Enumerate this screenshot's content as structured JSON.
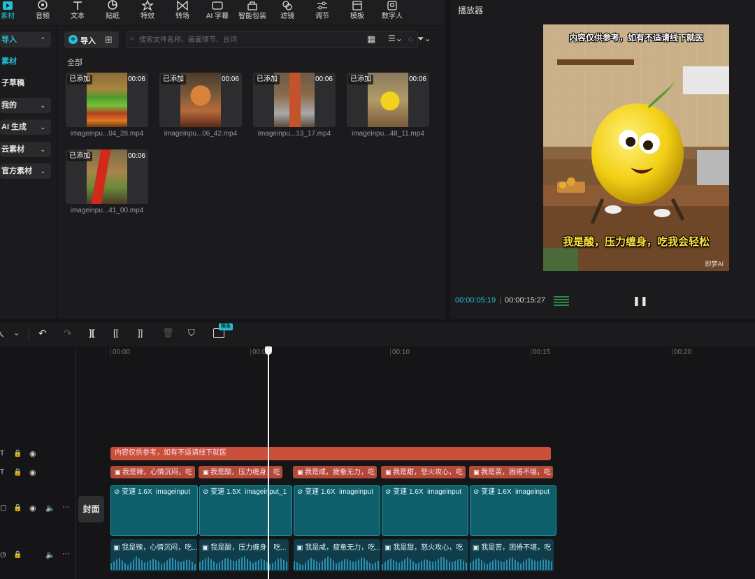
{
  "toolbar": {
    "tabs": [
      {
        "label": "素材",
        "icon": "media-icon"
      },
      {
        "label": "音频",
        "icon": "audio-icon"
      },
      {
        "label": "文本",
        "icon": "text-icon"
      },
      {
        "label": "贴纸",
        "icon": "sticker-icon"
      },
      {
        "label": "特效",
        "icon": "effects-icon"
      },
      {
        "label": "转场",
        "icon": "transition-icon"
      },
      {
        "label": "AI 字幕",
        "icon": "ai-caption-icon"
      },
      {
        "label": "智能包装",
        "icon": "smart-pack-icon"
      },
      {
        "label": "滤镜",
        "icon": "filter-icon"
      },
      {
        "label": "调节",
        "icon": "adjust-icon"
      },
      {
        "label": "模板",
        "icon": "template-icon"
      },
      {
        "label": "数字人",
        "icon": "digital-human-icon"
      }
    ],
    "active_color": "#22c1d6"
  },
  "left_nav": {
    "items": [
      {
        "label": "导入"
      },
      {
        "label": "素材"
      },
      {
        "label": "子草稿"
      },
      {
        "label": "我的"
      },
      {
        "label": "AI 生成"
      },
      {
        "label": "云素材"
      },
      {
        "label": "官方素材"
      }
    ]
  },
  "media": {
    "import_label": "导入",
    "search_placeholder": "搜索文件名称、画面情节、台词",
    "section_label": "全部",
    "added_badge": "已添加",
    "clips": [
      {
        "name": "imageinpu...04_28.mp4",
        "duration": "00:06"
      },
      {
        "name": "imageinpu...06_42.mp4",
        "duration": "00:06"
      },
      {
        "name": "imageinpu...13_17.mp4",
        "duration": "00:06"
      },
      {
        "name": "imageinpu...48_11.mp4",
        "duration": "00:06"
      },
      {
        "name": "imageinpu...41_00.mp4",
        "duration": "00:06"
      }
    ]
  },
  "player": {
    "title": "播放器",
    "subtitle_top": "内容仅供参考，如有不适请线下就医",
    "subtitle_bottom": "我是酸，压力缠身，吃我会轻松",
    "watermark": "即梦AI",
    "current_time": "00:00:05:19",
    "total_time": "00:00:15:27"
  },
  "timeline": {
    "new_badge": "限免",
    "ruler": [
      "00:00",
      "00:05",
      "00:10",
      "00:15",
      "00:20"
    ],
    "cover_label": "封面",
    "disclaimer_text": "内容仅供参考，如有不适请线下就医",
    "caption_segments": [
      "我是辣，心情沉闷，吃",
      "我是酸，压力缠身，吃",
      "我是咸，疲惫无力，吃",
      "我是甜，怒火攻心，吃",
      "我是苦，困倦不堪，吃"
    ],
    "video_segments": [
      {
        "speed": "变速 1.6X",
        "name": "imageinput"
      },
      {
        "speed": "变速 1.5X",
        "name": "imageinput_1"
      },
      {
        "speed": "变速 1.6X",
        "name": "imageinput"
      },
      {
        "speed": "变速 1.6X",
        "name": "imageinput"
      },
      {
        "speed": "变速 1.6X",
        "name": "imageinput"
      }
    ],
    "audio_segments": [
      "我是辣，心情沉闷，吃...",
      "我是酸，压力缠身，吃...",
      "我是咸，疲惫无力，吃...",
      "我是甜，怒火攻心，吃",
      "我是苦，困倦不堪，吃"
    ]
  }
}
